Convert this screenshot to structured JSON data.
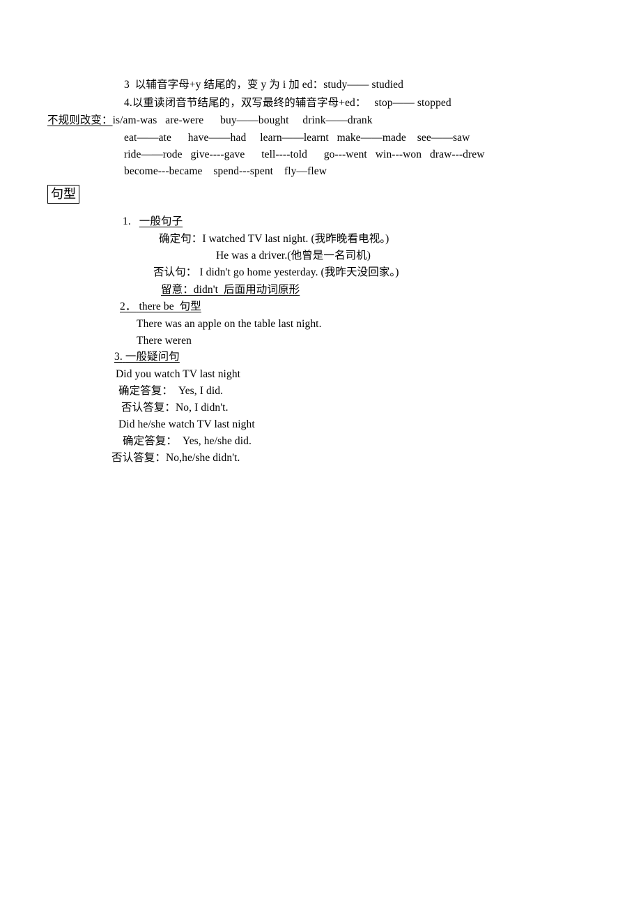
{
  "document": {
    "title_box": "句型",
    "spelling_rules": [
      {
        "id": "rule-3",
        "text": "3  以辅音字母+y 结尾的，变 y 为 i 加 ed：study—— studied"
      },
      {
        "id": "rule-4",
        "text": "4.以重读闭音节结尾的，双写最终的辅音字母+ed：   stop—— stopped"
      }
    ],
    "irregular": {
      "label": "不规则改变：",
      "first_line_rest": "is/am-was   are-were      buy——bought     drink——drank",
      "rows": [
        "eat——ate      have——had     learn——learnt   make——made    see——saw",
        "ride——rode   give----gave      tell----told      go---went   win---won   draw---drew",
        "become---became    spend---spent    fly—flew"
      ]
    },
    "patterns": [
      {
        "number": "1.",
        "heading": "一般句子",
        "heading_underlined": true,
        "number_underlined": false,
        "lines": [
          {
            "text": "确定句：I watched TV last night. (我昨晚看电视。)",
            "indent": 228,
            "underline": false
          },
          {
            "text": "He was a driver.(他曾是一名司机)",
            "indent": 310,
            "underline": false
          },
          {
            "text": "否认句： I didn't go home yesterday. (我昨天没回家。)",
            "indent": 220,
            "underline": false
          },
          {
            "text": "留意：didn't  后面用动词原形",
            "indent": 231,
            "underline": true
          }
        ]
      },
      {
        "number": "2．",
        "heading": "there be  句型",
        "heading_underlined": true,
        "number_underlined": true,
        "lines": [
          {
            "text": "There was an apple on the table last night.",
            "indent": 196,
            "underline": false
          },
          {
            "text": "There weren",
            "indent": 196,
            "underline": false
          }
        ]
      },
      {
        "number": "3.",
        "heading": "一般疑问句",
        "heading_underlined": true,
        "number_underlined": true,
        "lines": [
          {
            "text": "Did you watch TV last night",
            "indent": 166,
            "underline": false
          },
          {
            "text": "确定答复：  Yes, I did.",
            "indent": 170,
            "underline": false
          },
          {
            "text": "否认答复：No, I didn't.",
            "indent": 174,
            "underline": false
          },
          {
            "text": "Did he/she watch TV last night",
            "indent": 170,
            "underline": false
          },
          {
            "text": "确定答复：  Yes, he/she did.",
            "indent": 176,
            "underline": false
          },
          {
            "text": "否认答复：No,he/she didn't.",
            "indent": 160,
            "underline": false
          }
        ]
      }
    ]
  }
}
